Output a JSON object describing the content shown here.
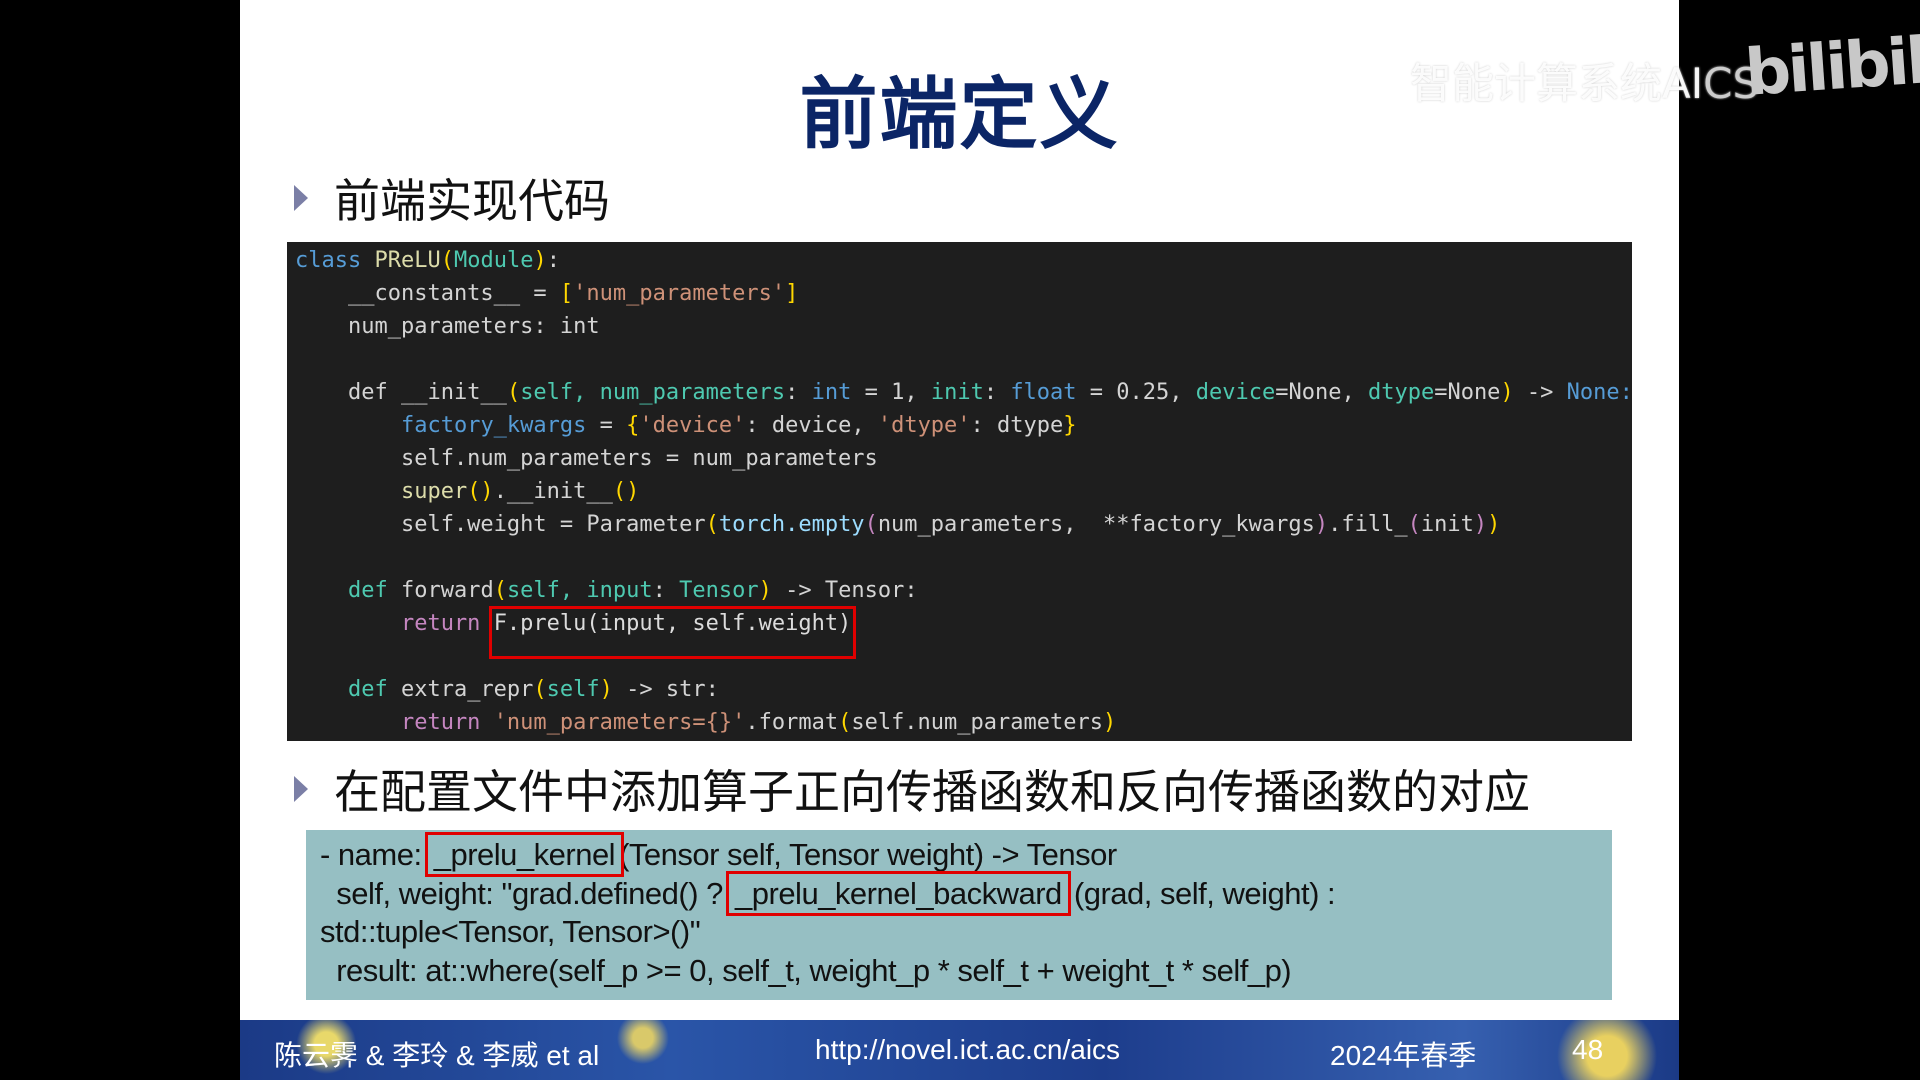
{
  "slide": {
    "title": "前端定义",
    "bullet1": "前端实现代码",
    "bullet2": "在配置文件中添加算子正向传播函数和反向传播函数的对应",
    "code_lines": [
      [
        [
          "class ",
          "k"
        ],
        [
          "PReLU",
          "y"
        ],
        [
          "(",
          "b"
        ],
        [
          "Module",
          "g"
        ],
        [
          ")",
          "b"
        ],
        [
          ":",
          "w"
        ]
      ],
      [
        [
          "    __constants__ = ",
          "w"
        ],
        [
          "[",
          "b"
        ],
        [
          "'num_parameters'",
          "s"
        ],
        [
          "]",
          "b"
        ]
      ],
      [
        [
          "    num_parameters: int",
          "w"
        ]
      ],
      [],
      [
        [
          "    def ",
          "w"
        ],
        [
          "__init__",
          "w"
        ],
        [
          "(",
          "b"
        ],
        [
          "self, num_parameters",
          "g"
        ],
        [
          ": ",
          "w"
        ],
        [
          "int",
          "k"
        ],
        [
          " = 1, ",
          "w"
        ],
        [
          "init",
          "g"
        ],
        [
          ": ",
          "w"
        ],
        [
          "float",
          "k"
        ],
        [
          " = 0.25, ",
          "w"
        ],
        [
          "device",
          "g"
        ],
        [
          "=None, ",
          "w"
        ],
        [
          "dtype",
          "g"
        ],
        [
          "=None",
          "w"
        ],
        [
          ")",
          "b"
        ],
        [
          " -> ",
          "w"
        ],
        [
          "None:",
          "k"
        ]
      ],
      [
        [
          "        ",
          "w"
        ],
        [
          "factory_kwargs",
          "k"
        ],
        [
          " = ",
          "w"
        ],
        [
          "{",
          "b"
        ],
        [
          "'device'",
          "s"
        ],
        [
          ": device, ",
          "w"
        ],
        [
          "'dtype'",
          "s"
        ],
        [
          ": dtype",
          "w"
        ],
        [
          "}",
          "b"
        ]
      ],
      [
        [
          "        self.num_parameters = num_parameters",
          "w"
        ]
      ],
      [
        [
          "        super",
          "y"
        ],
        [
          "()",
          "b"
        ],
        [
          ".__init__",
          "w"
        ],
        [
          "()",
          "b"
        ]
      ],
      [
        [
          "        self.weight = Parameter",
          "w"
        ],
        [
          "(",
          "b"
        ],
        [
          "torch.empty",
          "t"
        ],
        [
          "(",
          "p"
        ],
        [
          "num_parameters,  **factory_kwargs",
          "w"
        ],
        [
          ")",
          "p"
        ],
        [
          ".fill_",
          "w"
        ],
        [
          "(",
          "p"
        ],
        [
          "init",
          "w"
        ],
        [
          ")",
          "p"
        ],
        [
          ")",
          "b"
        ]
      ],
      [],
      [
        [
          "    def ",
          "g"
        ],
        [
          "forward",
          "w"
        ],
        [
          "(",
          "b"
        ],
        [
          "self, input",
          "g"
        ],
        [
          ": ",
          "w"
        ],
        [
          "Tensor",
          "g"
        ],
        [
          ")",
          "b"
        ],
        [
          " -> Tensor:",
          "w"
        ]
      ],
      [
        [
          "        return ",
          "p"
        ],
        [
          "F.prelu(input, self.weight)",
          "hl"
        ]
      ],
      [],
      [
        [
          "    def ",
          "g"
        ],
        [
          "extra_repr",
          "w"
        ],
        [
          "(",
          "b"
        ],
        [
          "self",
          "g"
        ],
        [
          ")",
          "b"
        ],
        [
          " -> str:",
          "w"
        ]
      ],
      [
        [
          "        return ",
          "p"
        ],
        [
          "'num_parameters={}'",
          "s"
        ],
        [
          ".format",
          "w"
        ],
        [
          "(",
          "b"
        ],
        [
          "self.num_parameters",
          "w"
        ],
        [
          ")",
          "b"
        ]
      ]
    ],
    "config": {
      "l1_a": "- name: ",
      "l1_box": "_prelu_kernel",
      "l1_b": "(Tensor self, Tensor weight) -> Tensor",
      "l2_a": "  self, weight: \"grad.defined() ? ",
      "l2_box": "_prelu_kernel_backward",
      "l2_b": "(grad, self, weight) :",
      "l3": "std::tuple<Tensor, Tensor>()\"",
      "l4": "  result: at::where(self_p >= 0, self_t, weight_p * self_t + weight_t * self_p)"
    },
    "footer": {
      "authors": "陈云霁 & 李玲 & 李威 et al",
      "url": "http://novel.ict.ac.cn/aics",
      "term": "2024年春季",
      "page": "48"
    }
  },
  "watermark": {
    "course": "智能计算系统AI",
    "course_cs": "CS",
    "platform": "bilibili"
  },
  "colors": {
    "title": "#0b2566",
    "code_bg": "#1e1e1e",
    "config_bg": "#96bfc3",
    "highlight": "#e00000"
  }
}
